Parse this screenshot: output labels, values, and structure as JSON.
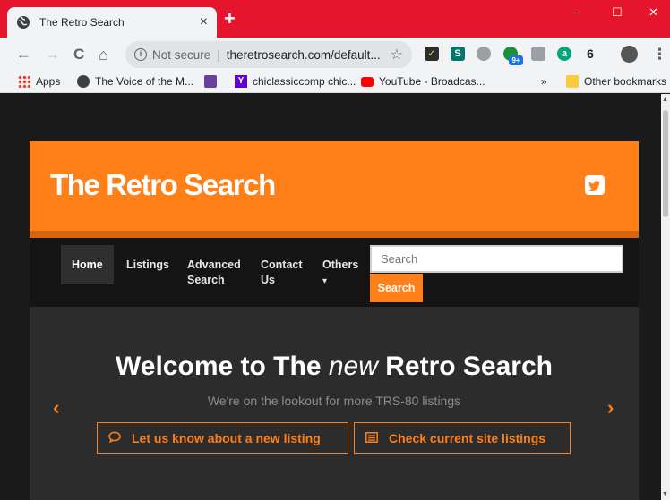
{
  "browser": {
    "tab_title": "The Retro Search",
    "tab_close": "×",
    "new_tab": "+",
    "window_minimize": "–",
    "window_maximize": "☐",
    "window_close": "✕",
    "nav_back": "←",
    "nav_forward": "→",
    "nav_reload": "C",
    "nav_home": "⌂",
    "security_label": "Not secure",
    "separator": "|",
    "url": "theretrosearch.com/default...",
    "star": "☆",
    "menu": "⋮",
    "extension_badge": "9+",
    "bookmarks_more": "»",
    "bookmarks": [
      {
        "label": "Apps"
      },
      {
        "label": "The Voice of the M..."
      },
      {
        "label": "chiclassiccomp chic..."
      },
      {
        "label": "YouTube - Broadcas..."
      },
      {
        "label": "Other bookmarks"
      }
    ]
  },
  "site": {
    "title": "The Retro Search",
    "nav": [
      {
        "label": "Home"
      },
      {
        "label": "Listings"
      },
      {
        "label": "Advanced Search"
      },
      {
        "label": "Contact Us"
      },
      {
        "label": "Others"
      }
    ],
    "dropdown_caret": "▾",
    "search_placeholder": "Search",
    "search_button": "Search",
    "hero": {
      "heading_prefix": "Welcome to The",
      "heading_em": "new",
      "heading_suffix": "Retro Search",
      "tagline": "We're on the lookout for more TRS-80 listings",
      "prev": "‹",
      "next": "›",
      "cta1": "Let us know about a new listing",
      "cta2": "Check current site listings"
    }
  },
  "colors": {
    "tabstrip": "#e4152d",
    "accent": "#ff7f18",
    "nav_bg": "#141414",
    "hero_bg": "#2c2c2c"
  }
}
